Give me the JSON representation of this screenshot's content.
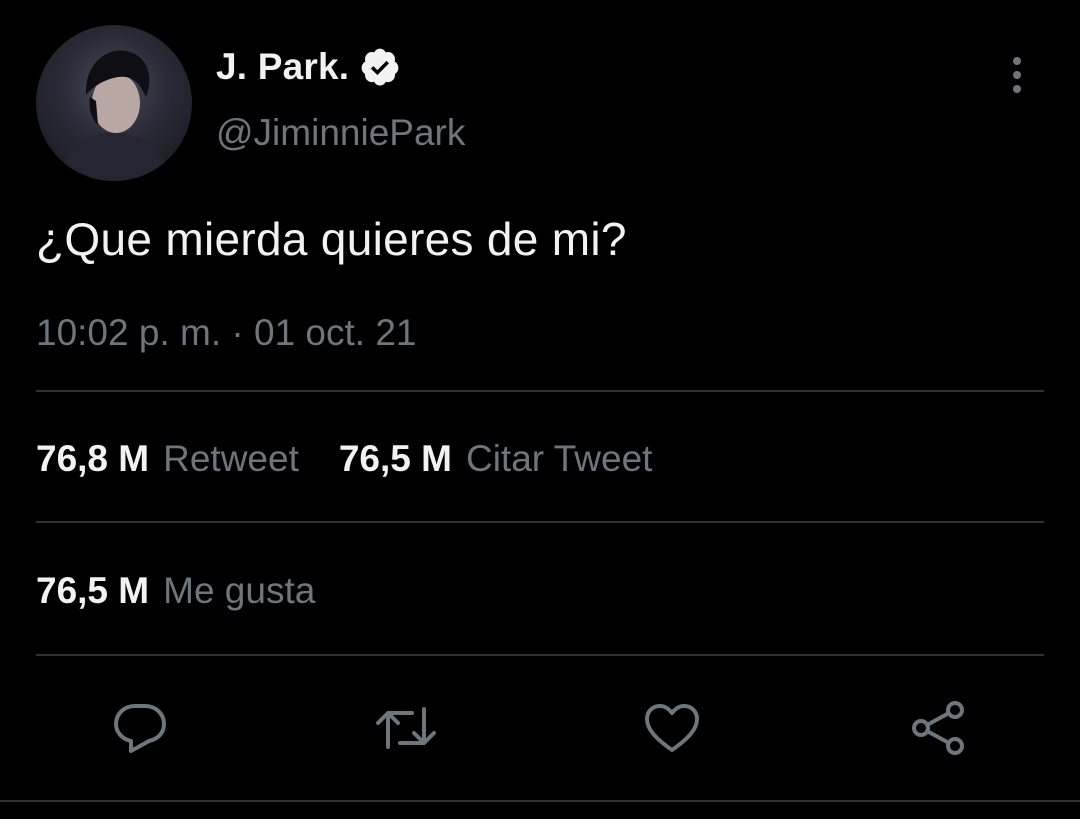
{
  "author": {
    "display_name": "J. Park.",
    "handle": "@JiminniePark",
    "verified": true,
    "avatar": "profile-photo-avatar"
  },
  "tweet": {
    "text": "¿Que mierda quieres de mi?",
    "timestamp": "10:02 p. m. · 01 oct. 21"
  },
  "stats": {
    "retweets": {
      "count": "76,8 M",
      "label": "Retweet"
    },
    "quotes": {
      "count": "76,5 M",
      "label": "Citar Tweet"
    },
    "likes": {
      "count": "76,5 M",
      "label": "Me gusta"
    }
  },
  "actions": {
    "reply": "reply-icon",
    "retweet": "retweet-icon",
    "like": "heart-icon",
    "share": "share-icon"
  },
  "colors": {
    "background": "#000000",
    "primary_text": "#f2f2f2",
    "secondary_text": "#6e767d",
    "divider": "#2f3336",
    "icon": "#6e767d"
  }
}
